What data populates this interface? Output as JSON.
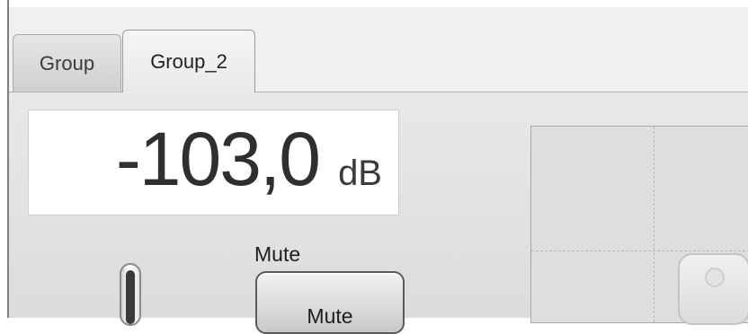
{
  "tabs": [
    {
      "label": "Group",
      "active": false
    },
    {
      "label": "Group_2",
      "active": true
    }
  ],
  "level": {
    "value": "-103,0",
    "unit": "dB"
  },
  "mute": {
    "label": "Mute",
    "button_label": "Mute"
  },
  "icons": {
    "speaker": "speaker-icon",
    "fader": "fader-icon"
  },
  "colors": {
    "panel_bg": "#e2e2e2",
    "level_box_bg": "#ffffff",
    "tab_border": "#a9a9a9"
  }
}
